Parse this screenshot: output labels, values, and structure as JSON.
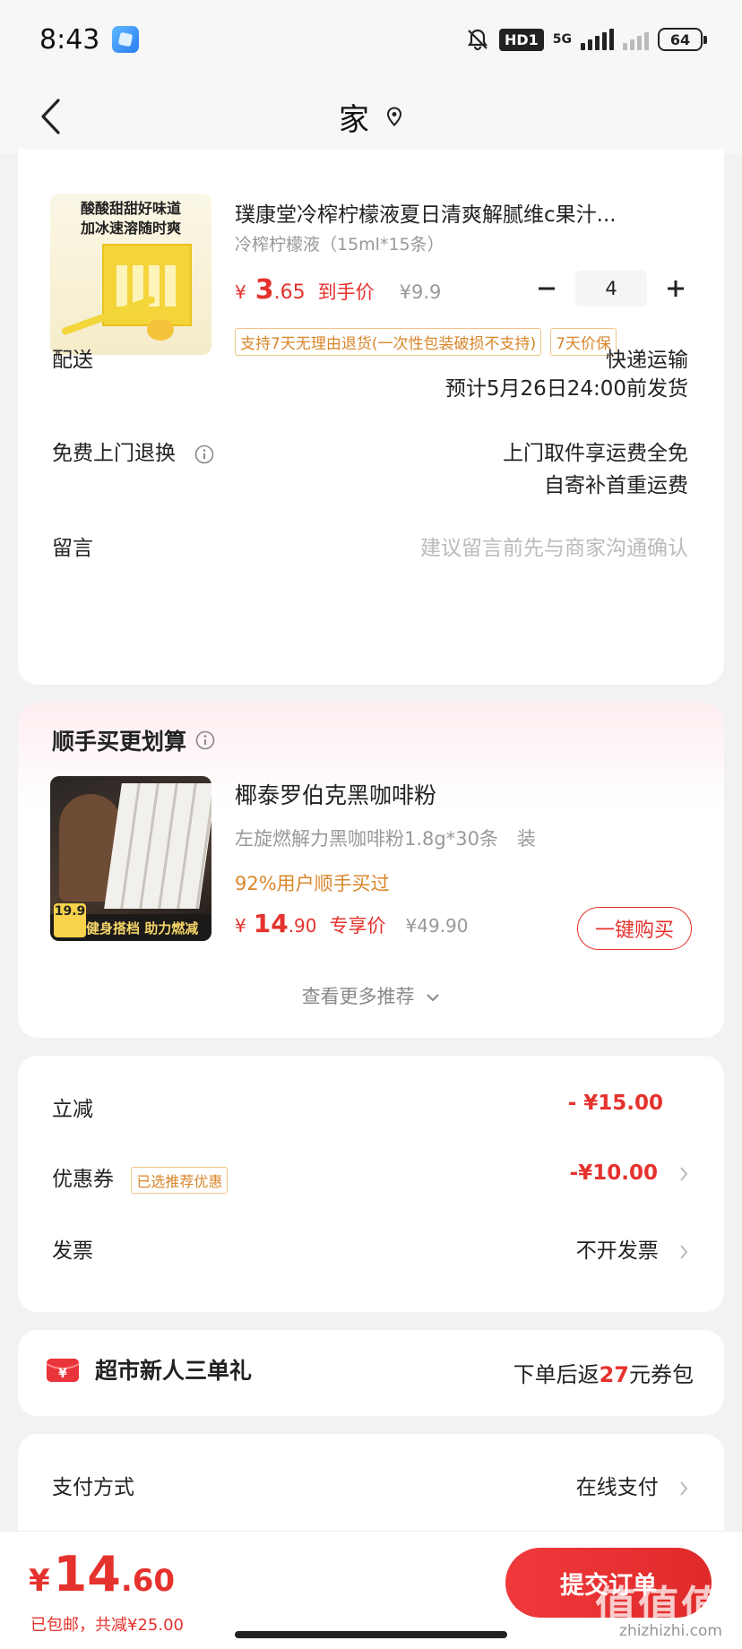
{
  "status_bar": {
    "time": "8:43",
    "hd": "HD1",
    "network": "5G",
    "battery": "64"
  },
  "nav": {
    "title": "家"
  },
  "product": {
    "title": "璞康堂冷榨柠檬液夏日清爽解腻维c果汁...",
    "spec": "冷榨柠檬液（15ml*15条）",
    "price_currency": "¥",
    "price_int": "3",
    "price_dec": ".65",
    "price_label": "到手价",
    "orig_price": "¥9.9",
    "quantity": "4",
    "tags": [
      "支持7天无理由退货(一次性包装破损不支持)",
      "7天价保"
    ],
    "thumb_text_line1": "酸酸甜甜好味道",
    "thumb_text_line2": "加冰速溶随时爽"
  },
  "delivery": {
    "label": "配送",
    "method": "快递运输",
    "eta": "预计5月26日24:00前发货"
  },
  "returns": {
    "label": "免费上门退换",
    "line1": "上门取件享运费全免",
    "line2": "自寄补首重运费"
  },
  "message": {
    "label": "留言",
    "placeholder": "建议留言前先与商家沟通确认"
  },
  "recommend": {
    "section_title": "顺手买更划算",
    "title": "椰泰罗伯克黑咖啡粉",
    "spec": "左旋燃解力黑咖啡粉1.8g*30条　装",
    "social": "92%用户顺手买过",
    "price_currency": "¥",
    "price_int": "14",
    "price_dec": ".90",
    "price_label": "专享价",
    "orig_price": "¥49.90",
    "buy_label": "一键购买",
    "more_label": "查看更多推荐",
    "thumb_badge": "19.9",
    "thumb_band": "健身搭档 助力燃减"
  },
  "summary": {
    "discount_label": "立减",
    "discount_value": "- ¥15.00",
    "coupon_label": "优惠券",
    "coupon_tag": "已选推荐优惠",
    "coupon_value": "-¥10.00",
    "invoice_label": "发票",
    "invoice_value": "不开发票"
  },
  "gift": {
    "title": "超市新人三单礼",
    "prefix": "下单后返",
    "amount": "27",
    "suffix": "元券包"
  },
  "payment": {
    "label": "支付方式",
    "value": "在线支付"
  },
  "bottom": {
    "currency": "¥",
    "total_int": "14",
    "total_dec": ".60",
    "sub": "已包邮，共减¥25.00",
    "submit_label": "提交订单"
  },
  "watermark": {
    "text": "值值值",
    "url": "zhizhizhi.com"
  },
  "colors": {
    "accent": "#e5322d",
    "tag": "#d9862b",
    "background": "#f2f2f2"
  }
}
